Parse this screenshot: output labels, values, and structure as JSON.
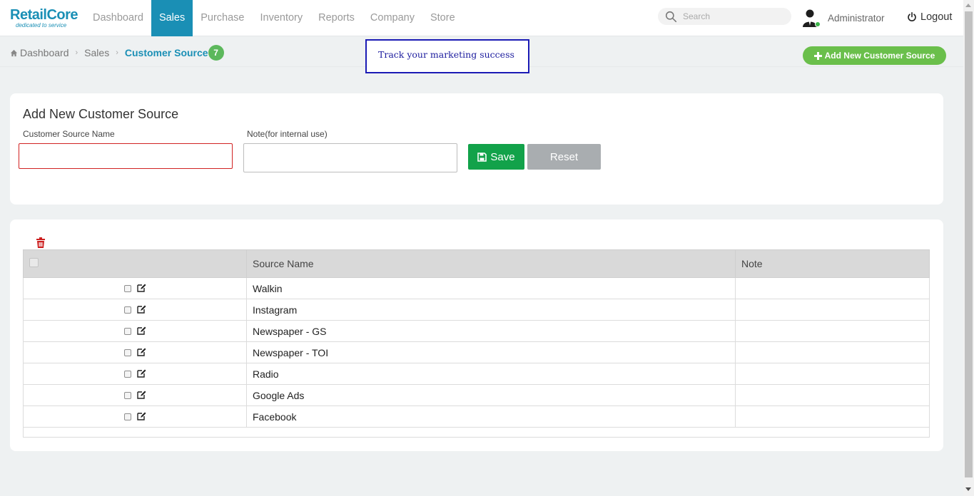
{
  "brand": {
    "name": "RetailCore",
    "tagline": "dedicated to service"
  },
  "nav": [
    {
      "label": "Dashboard",
      "active": false
    },
    {
      "label": "Sales",
      "active": true
    },
    {
      "label": "Purchase",
      "active": false
    },
    {
      "label": "Inventory",
      "active": false
    },
    {
      "label": "Reports",
      "active": false
    },
    {
      "label": "Company",
      "active": false
    },
    {
      "label": "Store",
      "active": false
    }
  ],
  "search": {
    "placeholder": "Search",
    "icon": "search-icon"
  },
  "user": {
    "name": "Administrator",
    "status": "online"
  },
  "logout": {
    "label": "Logout"
  },
  "breadcrumb": {
    "home": "Dashboard",
    "section": "Sales",
    "current": "Customer Source",
    "count": "7"
  },
  "banner": {
    "text": "Track your marketing success"
  },
  "add_button": {
    "label": "Add New Customer Source"
  },
  "form": {
    "title": "Add New Customer Source",
    "name_label": "Customer Source Name",
    "name_value": "",
    "note_label": "Note(for internal use)",
    "note_value": "",
    "save_label": "Save",
    "reset_label": "Reset"
  },
  "table": {
    "headers": [
      "",
      "Source Name",
      "Note"
    ],
    "rows": [
      {
        "name": "Walkin",
        "note": ""
      },
      {
        "name": "Instagram",
        "note": ""
      },
      {
        "name": "Newspaper - GS",
        "note": ""
      },
      {
        "name": "Newspaper - TOI",
        "note": ""
      },
      {
        "name": "Radio",
        "note": ""
      },
      {
        "name": "Google Ads",
        "note": ""
      },
      {
        "name": "Facebook",
        "note": ""
      }
    ]
  },
  "colors": {
    "brand": "#1a8fb5",
    "save": "#12a24a",
    "add": "#6abf4b",
    "delete": "#cc1f1f",
    "banner_border": "#1b1bb5"
  }
}
